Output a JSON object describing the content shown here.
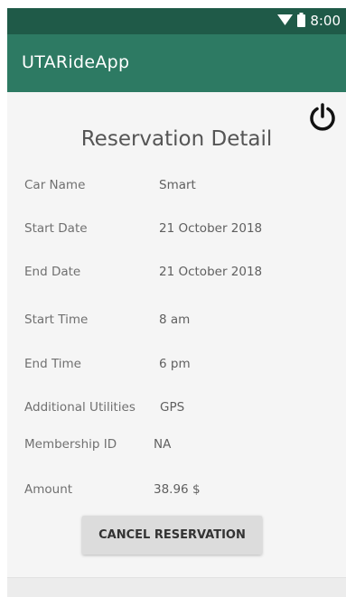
{
  "status_bar": {
    "time": "8:00",
    "icons": [
      "wifi-icon",
      "battery-icon"
    ]
  },
  "app_bar": {
    "title": "UTARideApp"
  },
  "header": {
    "title": "Reservation Detail",
    "power_icon": "power-icon"
  },
  "details": [
    {
      "label": "Car Name",
      "value": "Smart"
    },
    {
      "label": "Start Date",
      "value": "21 October 2018"
    },
    {
      "label": "End Date",
      "value": "21 October 2018"
    },
    {
      "label": "Start Time",
      "value": "8 am"
    },
    {
      "label": "End Time",
      "value": "6 pm"
    },
    {
      "label": "Additional Utilities",
      "value": "GPS"
    },
    {
      "label": "Membership ID",
      "value": "NA"
    },
    {
      "label": "Amount",
      "value": "38.96 $"
    }
  ],
  "actions": {
    "cancel_label": "CANCEL RESERVATION"
  },
  "colors": {
    "status_bar": "#1f5a48",
    "app_bar": "#2d7a63",
    "background": "#f5f5f5",
    "button": "#dcdcdc"
  }
}
